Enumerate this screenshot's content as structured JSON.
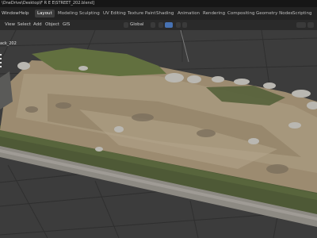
{
  "window": {
    "title": "\\OneDrive\\Desktop\\F R E E\\STREET_202.blend]"
  },
  "menu": {
    "items": [
      "Window",
      "Help"
    ],
    "workspaces": [
      "Layout",
      "Modeling",
      "Sculpting",
      "UV Editing",
      "Texture Paint",
      "Shading",
      "Animation",
      "Rendering",
      "Compositing",
      "Geometry Nodes",
      "Scripting"
    ],
    "active_workspace": "Layout"
  },
  "viewport_header": {
    "items": [
      "View",
      "Select",
      "Add",
      "Object",
      "GIS"
    ],
    "transform_orientation": "Global"
  },
  "outliner": {
    "object_label": "ack_202"
  },
  "colors": {
    "accent": "#4772b3",
    "background": "#393939",
    "grid": "#2f2f2f"
  }
}
